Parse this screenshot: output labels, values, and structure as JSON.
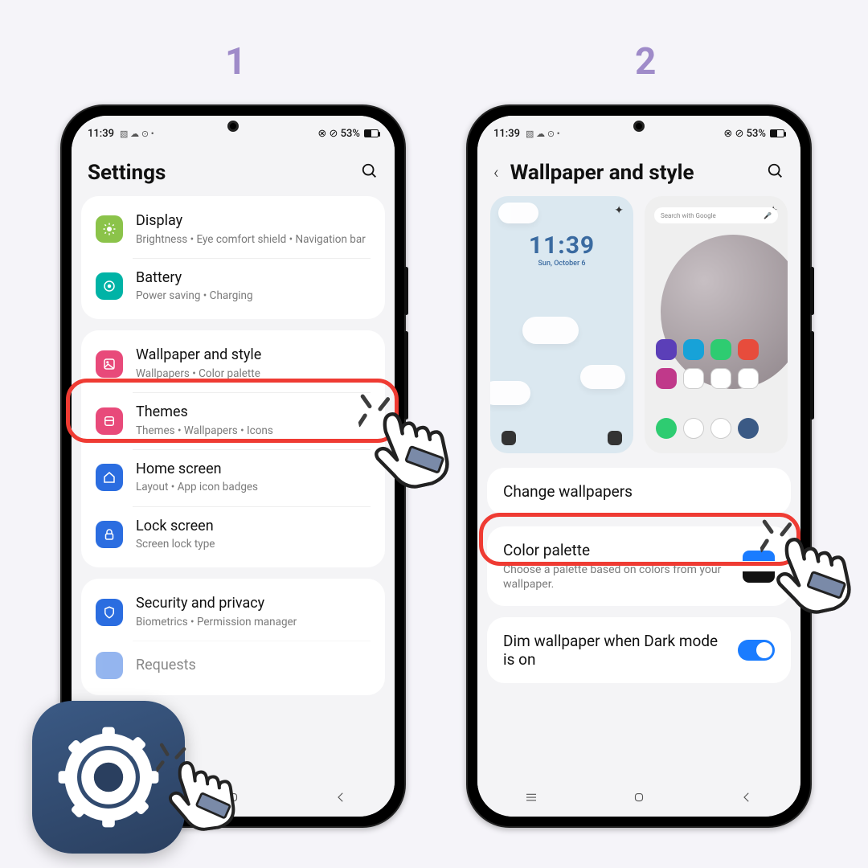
{
  "steps": {
    "one": "1",
    "two": "2"
  },
  "status": {
    "time": "11:39",
    "left_extra": "▧ ☁ ⊙ •",
    "right": "⊗ ⊘ 53%"
  },
  "screen1": {
    "title": "Settings",
    "items": [
      {
        "key": "display",
        "name": "Display",
        "sub": "Brightness  •  Eye comfort shield  •  Navigation bar",
        "color": "#8bc34a"
      },
      {
        "key": "battery",
        "name": "Battery",
        "sub": "Power saving  •  Charging",
        "color": "#00b3a6"
      },
      {
        "key": "wallpaper",
        "name": "Wallpaper and style",
        "sub": "Wallpapers  •  Color palette",
        "color": "#e84a7a"
      },
      {
        "key": "themes",
        "name": "Themes",
        "sub": "Themes  •  Wallpapers  •  Icons",
        "color": "#e84a7a"
      },
      {
        "key": "home",
        "name": "Home screen",
        "sub": "Layout  •  App icon badges",
        "color": "#2b6de0"
      },
      {
        "key": "lock",
        "name": "Lock screen",
        "sub": "Screen lock type",
        "color": "#2b6de0"
      },
      {
        "key": "security",
        "name": "Security and privacy",
        "sub": "Biometrics  •  Permission manager",
        "color": "#2b6de0"
      },
      {
        "key": "requests",
        "name": "Requests",
        "sub": "",
        "color": "#2b6de0"
      }
    ]
  },
  "screen2": {
    "title": "Wallpaper and style",
    "lock_preview": {
      "time": "11:39",
      "date": "Sun, October 6"
    },
    "home_preview": {
      "search_placeholder": "Search with Google"
    },
    "change": "Change wallpapers",
    "palette": {
      "name": "Color palette",
      "sub": "Choose a palette based on colors from your wallpaper."
    },
    "dim": "Dim wallpaper when Dark mode is on",
    "dim_on": true
  }
}
